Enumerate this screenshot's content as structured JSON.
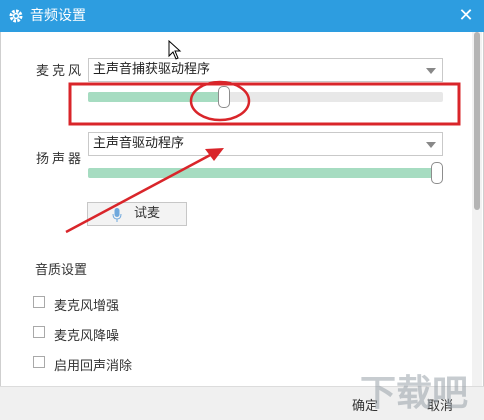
{
  "window": {
    "title": "音频设置",
    "close_glyph": "✕"
  },
  "microphone": {
    "label": "麦克风",
    "device": "主声音捕获驱动程序",
    "volume_percent": 38
  },
  "speaker": {
    "label": "扬声器",
    "device": "主声音驱动程序",
    "volume_percent": 100
  },
  "test_button": {
    "label": "试麦",
    "icon": "microphone-icon"
  },
  "quality": {
    "title": "音质设置",
    "options": [
      {
        "label": "麦克风增强",
        "checked": false
      },
      {
        "label": "麦克风降噪",
        "checked": false
      },
      {
        "label": "启用回声消除",
        "checked": false
      }
    ]
  },
  "footer": {
    "ok_label": "确定",
    "cancel_label": "取消"
  },
  "colors": {
    "titlebar": "#2d9de0",
    "slider_fill": "#a6dcc1",
    "annotation": "#d9252a"
  },
  "watermark": {
    "text": "下载吧"
  }
}
